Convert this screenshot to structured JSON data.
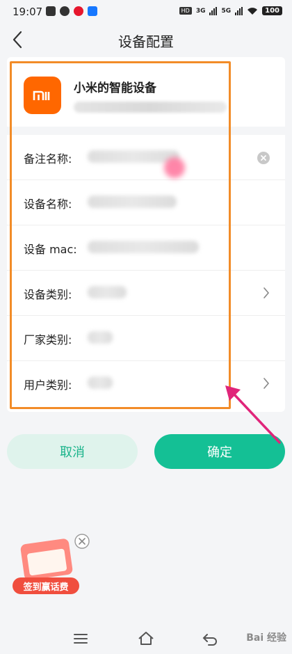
{
  "status_bar": {
    "time": "19:07",
    "hd_badge": "HD",
    "signal1": "3G",
    "signal2": "5G",
    "battery": "100"
  },
  "header": {
    "title": "设备配置",
    "back_icon": "chevron-left-icon"
  },
  "device": {
    "name": "小米的智能设备",
    "logo_text": "MI",
    "brand_color": "#ff6700"
  },
  "fields": [
    {
      "label": "备注名称:",
      "action": "clear-icon"
    },
    {
      "label": "设备名称:"
    },
    {
      "label": "设备 mac:"
    },
    {
      "label": "设备类别:",
      "action": "chevron-right-icon"
    },
    {
      "label": "厂家类别:"
    },
    {
      "label": "用户类别:",
      "action": "chevron-right-icon"
    }
  ],
  "buttons": {
    "cancel": "取消",
    "confirm": "确定"
  },
  "promo": {
    "label": "签到赢话费"
  },
  "nav": {
    "watermark": "Bai 经验"
  },
  "colors": {
    "accent": "#14c095",
    "accent_light": "#dff3ec",
    "annotation_box": "#f28c28",
    "annotation_arrow": "#e0257a"
  }
}
